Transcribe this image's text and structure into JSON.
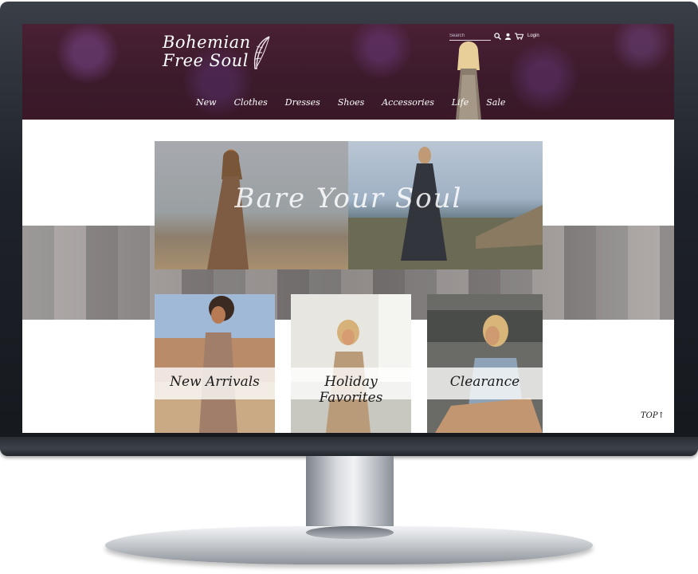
{
  "header": {
    "logo_line1": "Bohemian",
    "logo_line2": "Free Soul",
    "search_placeholder": "Search",
    "login_label": "Login"
  },
  "nav": {
    "items": [
      {
        "label": "New"
      },
      {
        "label": "Clothes"
      },
      {
        "label": "Dresses"
      },
      {
        "label": "Shoes"
      },
      {
        "label": "Accessories"
      },
      {
        "label": "Life"
      },
      {
        "label": "Sale"
      }
    ]
  },
  "hero": {
    "title": "Bare Your Soul"
  },
  "tiles": [
    {
      "label": "New Arrivals"
    },
    {
      "label": "Holiday Favorites"
    },
    {
      "label": "Clearance"
    }
  ],
  "footer": {
    "top_label": "TOP"
  },
  "colors": {
    "header_bg": "#3b1a2b",
    "nav_text": "#ffffff",
    "tile_label_bg": "#ffffff"
  }
}
